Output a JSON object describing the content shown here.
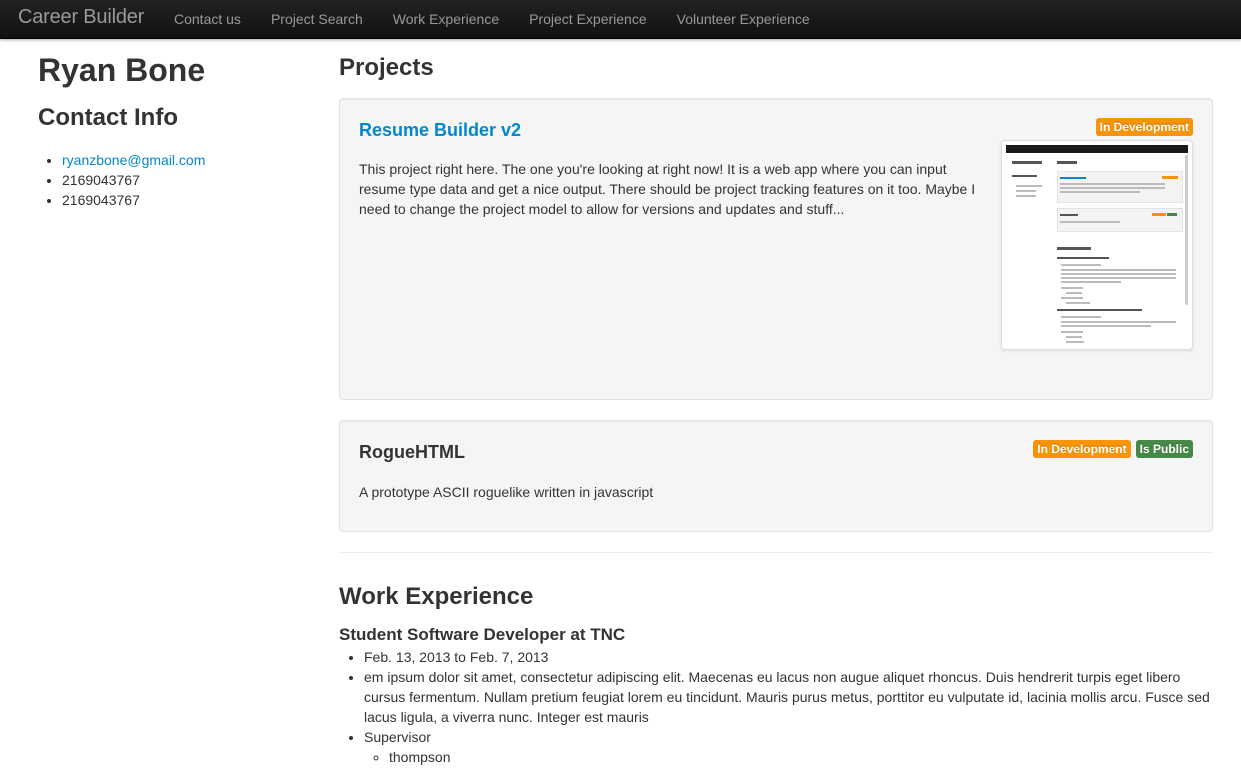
{
  "navbar": {
    "brand": "Career Builder",
    "items": [
      "Contact us",
      "Project Search",
      "Work Experience",
      "Project Experience",
      "Volunteer Experience"
    ]
  },
  "sidebar": {
    "name": "Ryan Bone",
    "contact_heading": "Contact Info",
    "contacts": [
      "ryanzbone@gmail.com",
      "2169043767",
      "2169043767"
    ]
  },
  "projects": {
    "heading": "Projects",
    "items": [
      {
        "title": "Resume Builder v2",
        "description": "This project right here. The one you're looking at right now! It is a web app where you can input resume type data and get a nice output. There should be project tracking features on it too. Maybe I need to change the project model to allow for versions and updates and stuff...",
        "badges": [
          "In Development"
        ]
      },
      {
        "title": "RogueHTML",
        "description": "A prototype ASCII roguelike written in javascript",
        "badges": [
          "In Development",
          "Is Public"
        ]
      }
    ]
  },
  "work": {
    "heading": "Work Experience",
    "jobs": [
      {
        "title": "Student Software Developer at TNC",
        "dates": "Feb. 13, 2013 to Feb. 7, 2013",
        "description": "em ipsum dolor sit amet, consectetur adipiscing elit. Maecenas eu lacus non augue aliquet rhoncus. Duis hendrerit turpis eget libero cursus fermentum. Nullam pretium feugiat lorem eu tincidunt. Mauris purus metus, porttitor eu vulputate id, lacinia mollis arcu. Fusce sed lacus ligula, a viverra nunc. Integer est mauris",
        "supervisor_label": "Supervisor",
        "supervisor": "thompson"
      }
    ]
  },
  "colors": {
    "link": "#0088cc",
    "badge_warning": "#f89406",
    "badge_success": "#468847",
    "navbar": "#1b1b1b"
  }
}
